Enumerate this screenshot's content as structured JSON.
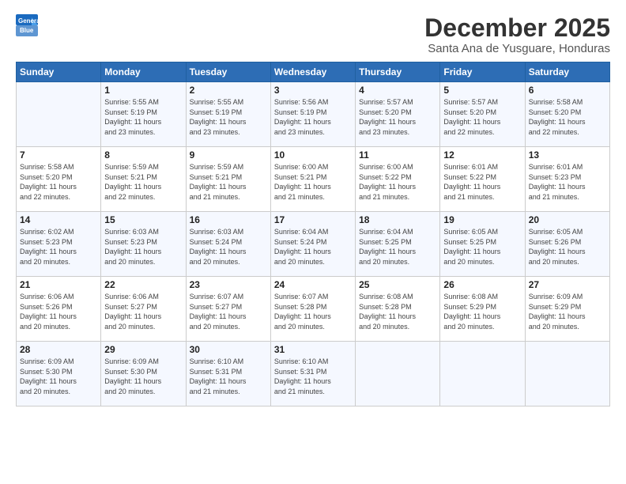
{
  "header": {
    "logo_line1": "General",
    "logo_line2": "Blue",
    "month_title": "December 2025",
    "location": "Santa Ana de Yusguare, Honduras"
  },
  "days_of_week": [
    "Sunday",
    "Monday",
    "Tuesday",
    "Wednesday",
    "Thursday",
    "Friday",
    "Saturday"
  ],
  "weeks": [
    [
      {
        "day": "",
        "info": ""
      },
      {
        "day": "1",
        "info": "Sunrise: 5:55 AM\nSunset: 5:19 PM\nDaylight: 11 hours\nand 23 minutes."
      },
      {
        "day": "2",
        "info": "Sunrise: 5:55 AM\nSunset: 5:19 PM\nDaylight: 11 hours\nand 23 minutes."
      },
      {
        "day": "3",
        "info": "Sunrise: 5:56 AM\nSunset: 5:19 PM\nDaylight: 11 hours\nand 23 minutes."
      },
      {
        "day": "4",
        "info": "Sunrise: 5:57 AM\nSunset: 5:20 PM\nDaylight: 11 hours\nand 23 minutes."
      },
      {
        "day": "5",
        "info": "Sunrise: 5:57 AM\nSunset: 5:20 PM\nDaylight: 11 hours\nand 22 minutes."
      },
      {
        "day": "6",
        "info": "Sunrise: 5:58 AM\nSunset: 5:20 PM\nDaylight: 11 hours\nand 22 minutes."
      }
    ],
    [
      {
        "day": "7",
        "info": "Sunrise: 5:58 AM\nSunset: 5:20 PM\nDaylight: 11 hours\nand 22 minutes."
      },
      {
        "day": "8",
        "info": "Sunrise: 5:59 AM\nSunset: 5:21 PM\nDaylight: 11 hours\nand 22 minutes."
      },
      {
        "day": "9",
        "info": "Sunrise: 5:59 AM\nSunset: 5:21 PM\nDaylight: 11 hours\nand 21 minutes."
      },
      {
        "day": "10",
        "info": "Sunrise: 6:00 AM\nSunset: 5:21 PM\nDaylight: 11 hours\nand 21 minutes."
      },
      {
        "day": "11",
        "info": "Sunrise: 6:00 AM\nSunset: 5:22 PM\nDaylight: 11 hours\nand 21 minutes."
      },
      {
        "day": "12",
        "info": "Sunrise: 6:01 AM\nSunset: 5:22 PM\nDaylight: 11 hours\nand 21 minutes."
      },
      {
        "day": "13",
        "info": "Sunrise: 6:01 AM\nSunset: 5:23 PM\nDaylight: 11 hours\nand 21 minutes."
      }
    ],
    [
      {
        "day": "14",
        "info": "Sunrise: 6:02 AM\nSunset: 5:23 PM\nDaylight: 11 hours\nand 20 minutes."
      },
      {
        "day": "15",
        "info": "Sunrise: 6:03 AM\nSunset: 5:23 PM\nDaylight: 11 hours\nand 20 minutes."
      },
      {
        "day": "16",
        "info": "Sunrise: 6:03 AM\nSunset: 5:24 PM\nDaylight: 11 hours\nand 20 minutes."
      },
      {
        "day": "17",
        "info": "Sunrise: 6:04 AM\nSunset: 5:24 PM\nDaylight: 11 hours\nand 20 minutes."
      },
      {
        "day": "18",
        "info": "Sunrise: 6:04 AM\nSunset: 5:25 PM\nDaylight: 11 hours\nand 20 minutes."
      },
      {
        "day": "19",
        "info": "Sunrise: 6:05 AM\nSunset: 5:25 PM\nDaylight: 11 hours\nand 20 minutes."
      },
      {
        "day": "20",
        "info": "Sunrise: 6:05 AM\nSunset: 5:26 PM\nDaylight: 11 hours\nand 20 minutes."
      }
    ],
    [
      {
        "day": "21",
        "info": "Sunrise: 6:06 AM\nSunset: 5:26 PM\nDaylight: 11 hours\nand 20 minutes."
      },
      {
        "day": "22",
        "info": "Sunrise: 6:06 AM\nSunset: 5:27 PM\nDaylight: 11 hours\nand 20 minutes."
      },
      {
        "day": "23",
        "info": "Sunrise: 6:07 AM\nSunset: 5:27 PM\nDaylight: 11 hours\nand 20 minutes."
      },
      {
        "day": "24",
        "info": "Sunrise: 6:07 AM\nSunset: 5:28 PM\nDaylight: 11 hours\nand 20 minutes."
      },
      {
        "day": "25",
        "info": "Sunrise: 6:08 AM\nSunset: 5:28 PM\nDaylight: 11 hours\nand 20 minutes."
      },
      {
        "day": "26",
        "info": "Sunrise: 6:08 AM\nSunset: 5:29 PM\nDaylight: 11 hours\nand 20 minutes."
      },
      {
        "day": "27",
        "info": "Sunrise: 6:09 AM\nSunset: 5:29 PM\nDaylight: 11 hours\nand 20 minutes."
      }
    ],
    [
      {
        "day": "28",
        "info": "Sunrise: 6:09 AM\nSunset: 5:30 PM\nDaylight: 11 hours\nand 20 minutes."
      },
      {
        "day": "29",
        "info": "Sunrise: 6:09 AM\nSunset: 5:30 PM\nDaylight: 11 hours\nand 20 minutes."
      },
      {
        "day": "30",
        "info": "Sunrise: 6:10 AM\nSunset: 5:31 PM\nDaylight: 11 hours\nand 21 minutes."
      },
      {
        "day": "31",
        "info": "Sunrise: 6:10 AM\nSunset: 5:31 PM\nDaylight: 11 hours\nand 21 minutes."
      },
      {
        "day": "",
        "info": ""
      },
      {
        "day": "",
        "info": ""
      },
      {
        "day": "",
        "info": ""
      }
    ]
  ]
}
